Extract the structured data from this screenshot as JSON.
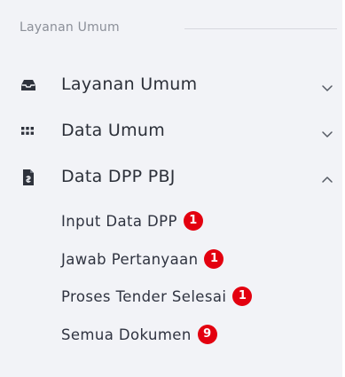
{
  "section": {
    "title": "Layanan Umum"
  },
  "menu": [
    {
      "label": "Layanan Umum",
      "icon": "inbox-icon",
      "expanded": false
    },
    {
      "label": "Data Umum",
      "icon": "grid-dots-icon",
      "expanded": false
    },
    {
      "label": "Data DPP PBJ",
      "icon": "document-icon",
      "expanded": true
    }
  ],
  "submenu": [
    {
      "label": "Input Data DPP",
      "badge": "1"
    },
    {
      "label": "Jawab Pertanyaan",
      "badge": "1"
    },
    {
      "label": "Proses Tender Selesai",
      "badge": "1"
    },
    {
      "label": "Semua Dokumen",
      "badge": "9"
    }
  ],
  "colors": {
    "badge": "#e3000f",
    "background": "#f2f3f7",
    "text": "#2b2f38"
  }
}
